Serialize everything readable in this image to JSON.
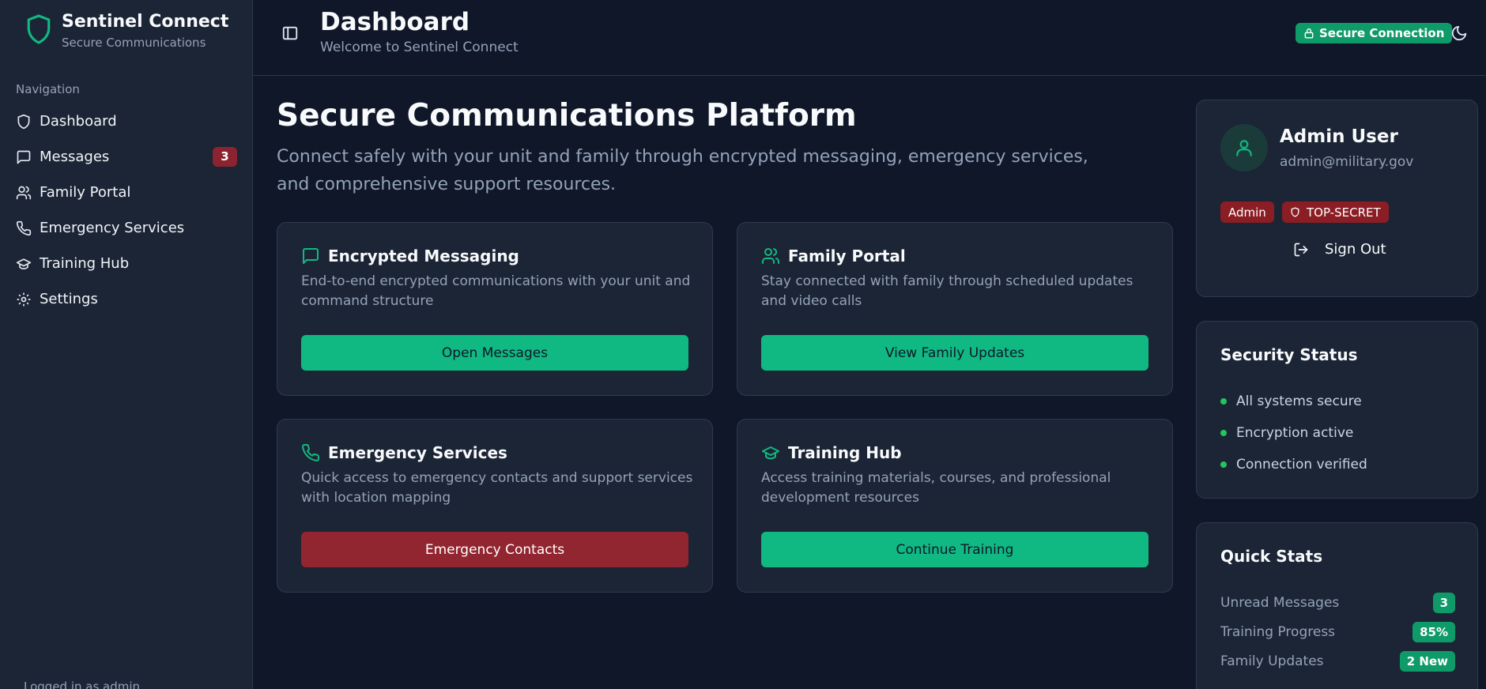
{
  "brand": {
    "title": "Sentinel Connect",
    "subtitle": "Secure Communications"
  },
  "sidebar": {
    "heading": "Navigation",
    "items": [
      {
        "label": "Dashboard",
        "icon": "shield-icon"
      },
      {
        "label": "Messages",
        "icon": "message-icon",
        "badge": "3"
      },
      {
        "label": "Family Portal",
        "icon": "users-icon"
      },
      {
        "label": "Emergency Services",
        "icon": "phone-icon"
      },
      {
        "label": "Training Hub",
        "icon": "graduation-cap-icon"
      },
      {
        "label": "Settings",
        "icon": "gear-icon"
      }
    ],
    "footer": "Logged in as admin"
  },
  "header": {
    "title": "Dashboard",
    "subtitle": "Welcome to Sentinel Connect",
    "badge": "Secure Connection"
  },
  "main": {
    "title": "Secure Communications Platform",
    "description": "Connect safely with your unit and family through encrypted messaging, emergency services, and comprehensive support resources.",
    "cards": [
      {
        "title": "Encrypted Messaging",
        "description": "End-to-end encrypted communications with your unit and command structure",
        "button": "Open Messages",
        "icon": "message-icon"
      },
      {
        "title": "Family Portal",
        "description": "Stay connected with family through scheduled updates and video calls",
        "button": "View Family Updates",
        "icon": "users-icon"
      },
      {
        "title": "Emergency Services",
        "description": "Quick access to emergency contacts and support services with location mapping",
        "button": "Emergency Contacts",
        "icon": "phone-icon"
      },
      {
        "title": "Training Hub",
        "description": "Access training materials, courses, and professional development resources",
        "button": "Continue Training",
        "icon": "graduation-cap-icon"
      }
    ]
  },
  "user": {
    "name": "Admin User",
    "email": "admin@military.gov",
    "role": "Admin",
    "clearance": "TOP-SECRET",
    "signout": "Sign Out"
  },
  "security": {
    "title": "Security Status",
    "items": [
      "All systems secure",
      "Encryption active",
      "Connection verified"
    ]
  },
  "stats": {
    "title": "Quick Stats",
    "rows": [
      {
        "label": "Unread Messages",
        "value": "3"
      },
      {
        "label": "Training Progress",
        "value": "85%"
      },
      {
        "label": "Family Updates",
        "value": "2 New"
      }
    ]
  },
  "colors": {
    "accent": "#10b981",
    "danger": "#912530",
    "background": "#0f1729",
    "surface": "#1c2535"
  }
}
